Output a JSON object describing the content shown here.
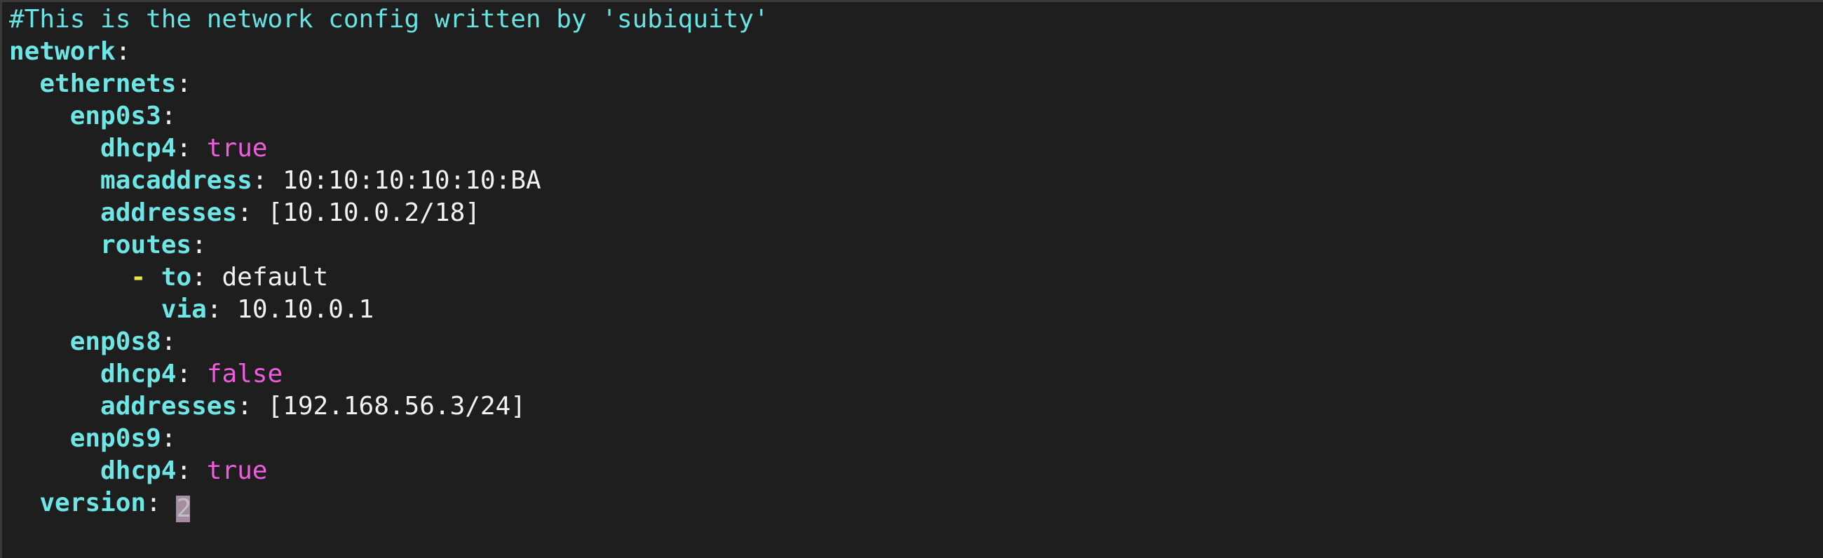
{
  "editor": {
    "lines": {
      "comment": "#This is the network config written by 'subiquity'",
      "network": {
        "indent": "",
        "key": "network"
      },
      "ethernets": {
        "indent": "  ",
        "key": "ethernets"
      },
      "enp0s3": {
        "indent": "    ",
        "key": "enp0s3"
      },
      "enp0s3_dhcp4": {
        "indent": "      ",
        "key": "dhcp4",
        "value": "true"
      },
      "enp0s3_macaddress": {
        "indent": "      ",
        "key": "macaddress",
        "value": "10:10:10:10:10:BA"
      },
      "enp0s3_addresses": {
        "indent": "      ",
        "key": "addresses",
        "value": "[10.10.0.2/18]"
      },
      "enp0s3_routes": {
        "indent": "      ",
        "key": "routes"
      },
      "route_to": {
        "indent": "        ",
        "dash": "-",
        "key": "to",
        "value": "default"
      },
      "route_via": {
        "indent": "          ",
        "key": "via",
        "value": "10.10.0.1"
      },
      "enp0s8": {
        "indent": "    ",
        "key": "enp0s8"
      },
      "enp0s8_dhcp4": {
        "indent": "      ",
        "key": "dhcp4",
        "value": "false"
      },
      "enp0s8_addresses": {
        "indent": "      ",
        "key": "addresses",
        "value": "[192.168.56.3/24]"
      },
      "enp0s9": {
        "indent": "    ",
        "key": "enp0s9"
      },
      "enp0s9_dhcp4": {
        "indent": "      ",
        "key": "dhcp4",
        "value": "true"
      },
      "version": {
        "indent": "  ",
        "key": "version",
        "value": "2"
      }
    },
    "colors": {
      "background": "#1e1e1e",
      "key": "#6fe6e6",
      "boolean": "#ef5ddf",
      "text": "#f2f2f2",
      "dash": "#e8e84a",
      "cursor": "#a48da3"
    }
  }
}
